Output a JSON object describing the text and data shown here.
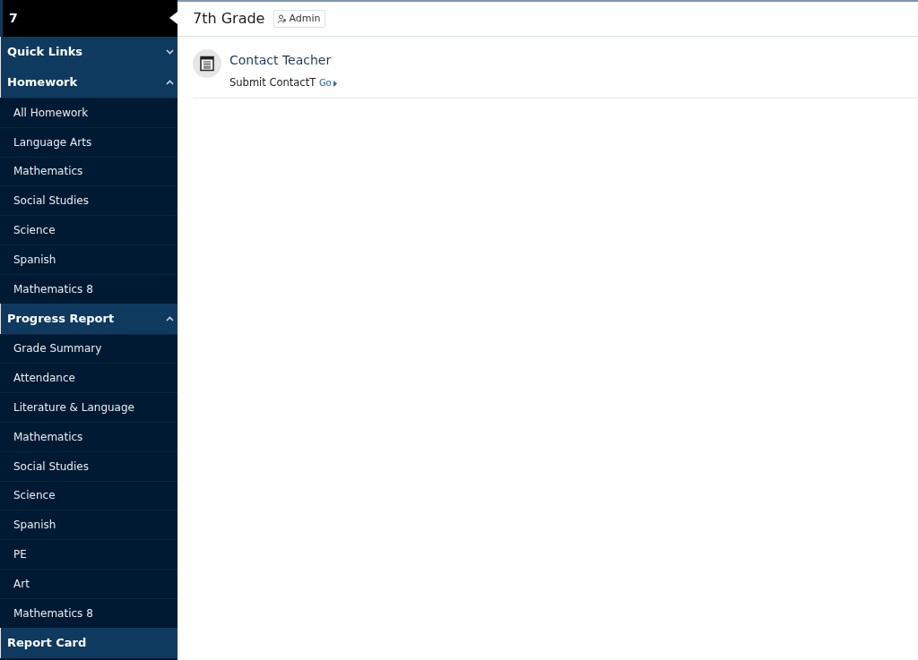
{
  "sidebar": {
    "title": "7",
    "sections": [
      {
        "label": "Quick Links",
        "expanded": false
      },
      {
        "label": "Homework",
        "expanded": true,
        "items": [
          "All Homework",
          "Language Arts",
          "Mathematics",
          "Social Studies",
          "Science",
          "Spanish",
          "Mathematics 8"
        ]
      },
      {
        "label": "Progress Report",
        "expanded": true,
        "items": [
          "Grade Summary",
          "Attendance",
          "Literature & Language",
          "Mathematics",
          "Social Studies",
          "Science",
          "Spanish",
          "PE",
          "Art",
          "Mathematics 8"
        ]
      },
      {
        "label": "Report Card"
      }
    ]
  },
  "header": {
    "title": "7th Grade",
    "badge": "Admin"
  },
  "links": [
    {
      "title": "Contact Teacher",
      "description": "Submit ContactT",
      "action": "Go"
    }
  ]
}
